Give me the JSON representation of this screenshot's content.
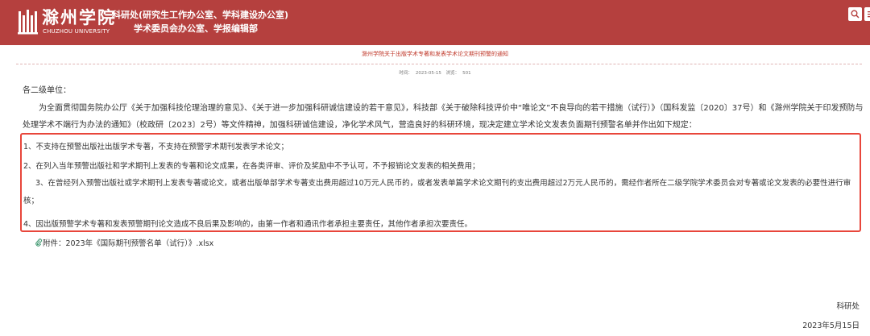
{
  "header": {
    "logo_text": "滁州学院",
    "logo_subtext": "CHUZHOU UNIVERSITY",
    "dept_line1": "科研处(研究生工作办公室、学科建设办公室)",
    "dept_line2": "学术委员会办公室、学报编辑部",
    "buttons": [
      "search-icon",
      "menu-icon"
    ]
  },
  "article": {
    "title": "滁州学院关于出版学术专著和发表学术论文期刊预警的通知",
    "time_label": "时间：",
    "time_value": "2023-05-15",
    "views_label": "浏览：",
    "views_value": "501",
    "salutation": "各二级单位：",
    "intro": "为全面贯彻国务院办公厅《关于加强科技伦理治理的意见》、《关于进一步加强科研诚信建设的若干意见》，科技部《关于破除科技评价中“唯论文”不良导向的若干措施（试行）》（国科发监〔2020〕37号）和《滁州学院关于印发预防与处理学术不端行为办法的通知》（校政研〔2023〕2号）等文件精神，加强科研诚信建设，净化学术风气，营造良好的科研环境，现决定建立学术论文发表负面期刊预警名单并作出如下规定：",
    "rules": [
      "1、不支持在预警出版社出版学术专著，不支持在预警学术期刊发表学术论文；",
      "2、在列入当年预警出版社和学术期刊上发表的专著和论文成果，在各类评审、评价及奖励中不予认可，不予报销论文发表的相关费用；",
      "3、在曾经列入预警出版社或学术期刊上发表专著或论文，或者出版单部学术专著支出费用超过10万元人民币的，或者发表单篇学术论文期刊的支出费用超过2万元人民币的，需经作者所在二级学院学术委员会对专著或论文发表的必要性进行审核；",
      "4、因出版预警学术专著和发表预警期刊论文造成不良后果及影响的，由第一作者和通讯作者承担主要责任，其他作者承担次要责任。"
    ],
    "attachment": "附件：2023年《国际期刊预警名单（试行）》.xlsx",
    "signature_org": "科研处",
    "signature_date": "2023年5月15日"
  },
  "colors": {
    "header_bg": "#b5403e",
    "title": "#c0392b",
    "highlight_border": "#e8463b"
  }
}
